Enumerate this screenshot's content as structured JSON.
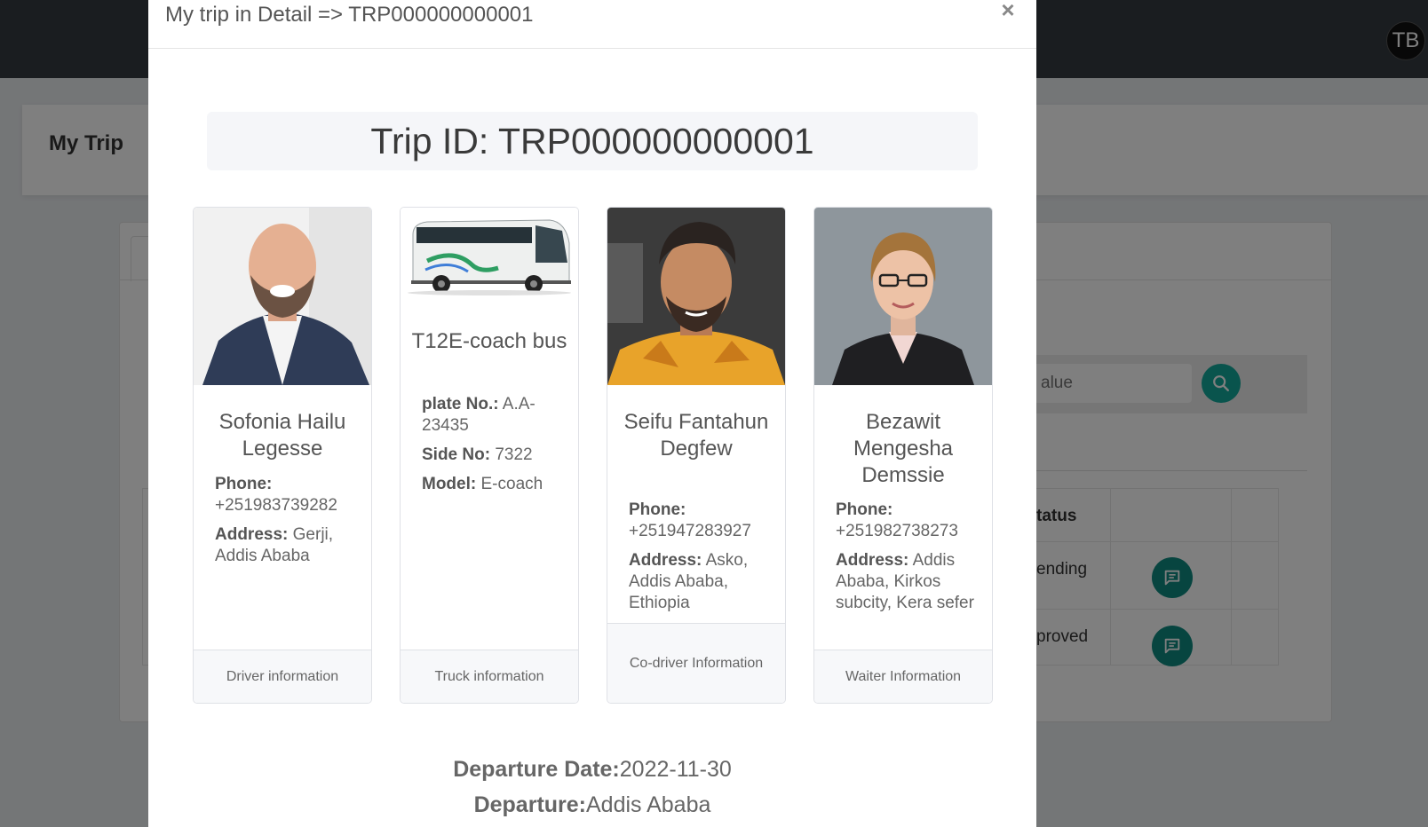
{
  "topbar": {
    "avatar_initials": "TB"
  },
  "page": {
    "title": "My Trip"
  },
  "search": {
    "placeholder": "alue"
  },
  "table": {
    "status_header": "tatus",
    "rows": [
      {
        "status": "ending"
      },
      {
        "status": "proved"
      }
    ]
  },
  "modal": {
    "title": "My trip in Detail => TRP000000000001",
    "close_symbol": "×",
    "trip_id_text": "Trip ID: TRP000000000001",
    "cards": [
      {
        "name": "Sofonia Hailu Legesse",
        "phone_label": "Phone:",
        "phone": "+251983739282",
        "address_label": "Address:",
        "address": "Gerji, Addis Ababa",
        "footer": "Driver information"
      },
      {
        "name": "T12E-coach bus",
        "plate_label": "plate No.:",
        "plate": "A.A-23435",
        "side_label": "Side No:",
        "side": "7322",
        "model_label": "Model:",
        "model": "E-coach",
        "footer": "Truck information"
      },
      {
        "name": "Seifu Fantahun Degfew",
        "phone_label": "Phone:",
        "phone": "+251947283927",
        "address_label": "Address:",
        "address": "Asko, Addis Ababa, Ethiopia",
        "footer": "Co-driver Information"
      },
      {
        "name": "Bezawit Mengesha Demssie",
        "phone_label": "Phone:",
        "phone": "+251982738273",
        "address_label": "Address:",
        "address": "Addis Ababa, Kirkos subcity, Kera sefer",
        "footer": "Waiter Information"
      }
    ],
    "departure_date_label": "Departure Date:",
    "departure_date": "2022-11-30",
    "departure_label": "Departure:",
    "departure": "Addis Ababa"
  },
  "colors": {
    "topbar": "#343a40",
    "accent_teal": "#12a89a",
    "chat_button": "#0f8a80"
  }
}
